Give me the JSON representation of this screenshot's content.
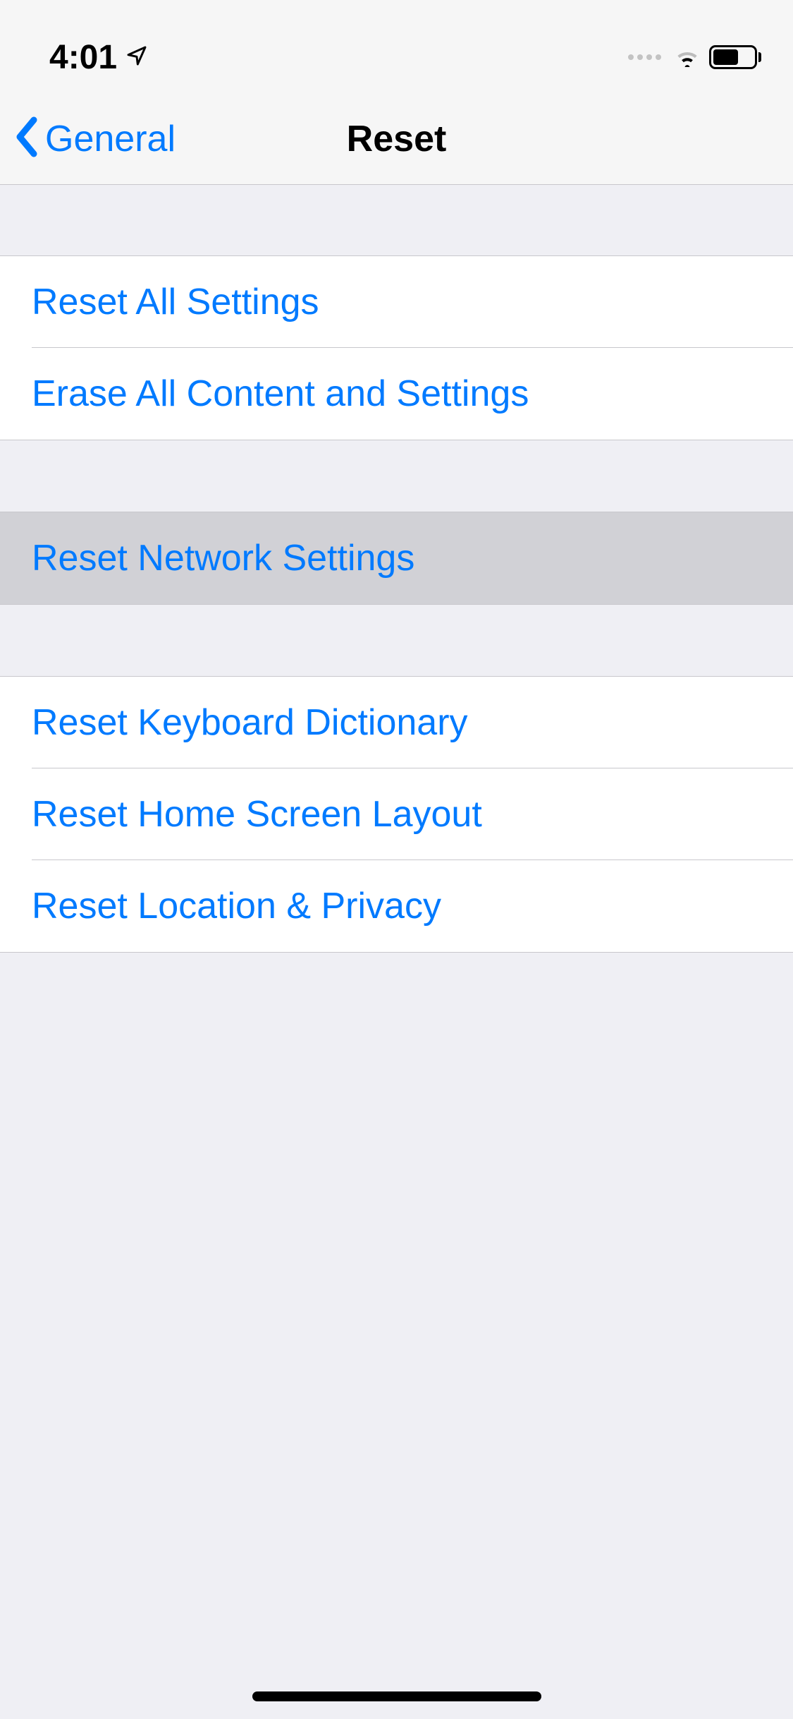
{
  "statusBar": {
    "time": "4:01"
  },
  "navBar": {
    "backLabel": "General",
    "title": "Reset"
  },
  "sections": {
    "group1": {
      "items": [
        {
          "label": "Reset All Settings"
        },
        {
          "label": "Erase All Content and Settings"
        }
      ]
    },
    "group2": {
      "items": [
        {
          "label": "Reset Network Settings"
        }
      ]
    },
    "group3": {
      "items": [
        {
          "label": "Reset Keyboard Dictionary"
        },
        {
          "label": "Reset Home Screen Layout"
        },
        {
          "label": "Reset Location & Privacy"
        }
      ]
    }
  }
}
